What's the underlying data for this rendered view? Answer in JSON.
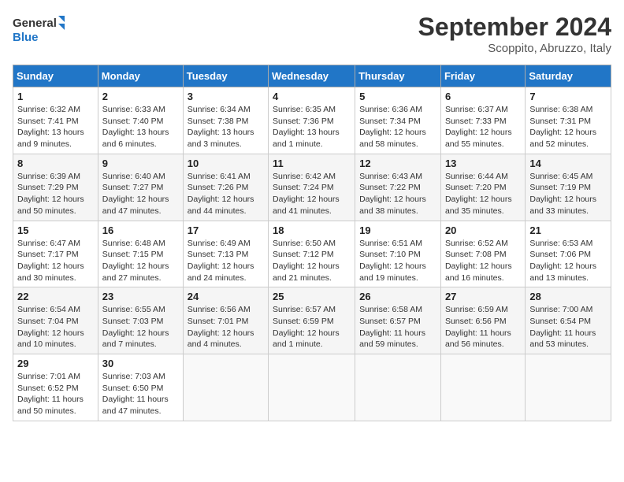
{
  "logo": {
    "line1": "General",
    "line2": "Blue"
  },
  "title": "September 2024",
  "subtitle": "Scoppito, Abruzzo, Italy",
  "days_of_week": [
    "Sunday",
    "Monday",
    "Tuesday",
    "Wednesday",
    "Thursday",
    "Friday",
    "Saturday"
  ],
  "weeks": [
    [
      {
        "day": "1",
        "detail": "Sunrise: 6:32 AM\nSunset: 7:41 PM\nDaylight: 13 hours\nand 9 minutes."
      },
      {
        "day": "2",
        "detail": "Sunrise: 6:33 AM\nSunset: 7:40 PM\nDaylight: 13 hours\nand 6 minutes."
      },
      {
        "day": "3",
        "detail": "Sunrise: 6:34 AM\nSunset: 7:38 PM\nDaylight: 13 hours\nand 3 minutes."
      },
      {
        "day": "4",
        "detail": "Sunrise: 6:35 AM\nSunset: 7:36 PM\nDaylight: 13 hours\nand 1 minute."
      },
      {
        "day": "5",
        "detail": "Sunrise: 6:36 AM\nSunset: 7:34 PM\nDaylight: 12 hours\nand 58 minutes."
      },
      {
        "day": "6",
        "detail": "Sunrise: 6:37 AM\nSunset: 7:33 PM\nDaylight: 12 hours\nand 55 minutes."
      },
      {
        "day": "7",
        "detail": "Sunrise: 6:38 AM\nSunset: 7:31 PM\nDaylight: 12 hours\nand 52 minutes."
      }
    ],
    [
      {
        "day": "8",
        "detail": "Sunrise: 6:39 AM\nSunset: 7:29 PM\nDaylight: 12 hours\nand 50 minutes."
      },
      {
        "day": "9",
        "detail": "Sunrise: 6:40 AM\nSunset: 7:27 PM\nDaylight: 12 hours\nand 47 minutes."
      },
      {
        "day": "10",
        "detail": "Sunrise: 6:41 AM\nSunset: 7:26 PM\nDaylight: 12 hours\nand 44 minutes."
      },
      {
        "day": "11",
        "detail": "Sunrise: 6:42 AM\nSunset: 7:24 PM\nDaylight: 12 hours\nand 41 minutes."
      },
      {
        "day": "12",
        "detail": "Sunrise: 6:43 AM\nSunset: 7:22 PM\nDaylight: 12 hours\nand 38 minutes."
      },
      {
        "day": "13",
        "detail": "Sunrise: 6:44 AM\nSunset: 7:20 PM\nDaylight: 12 hours\nand 35 minutes."
      },
      {
        "day": "14",
        "detail": "Sunrise: 6:45 AM\nSunset: 7:19 PM\nDaylight: 12 hours\nand 33 minutes."
      }
    ],
    [
      {
        "day": "15",
        "detail": "Sunrise: 6:47 AM\nSunset: 7:17 PM\nDaylight: 12 hours\nand 30 minutes."
      },
      {
        "day": "16",
        "detail": "Sunrise: 6:48 AM\nSunset: 7:15 PM\nDaylight: 12 hours\nand 27 minutes."
      },
      {
        "day": "17",
        "detail": "Sunrise: 6:49 AM\nSunset: 7:13 PM\nDaylight: 12 hours\nand 24 minutes."
      },
      {
        "day": "18",
        "detail": "Sunrise: 6:50 AM\nSunset: 7:12 PM\nDaylight: 12 hours\nand 21 minutes."
      },
      {
        "day": "19",
        "detail": "Sunrise: 6:51 AM\nSunset: 7:10 PM\nDaylight: 12 hours\nand 19 minutes."
      },
      {
        "day": "20",
        "detail": "Sunrise: 6:52 AM\nSunset: 7:08 PM\nDaylight: 12 hours\nand 16 minutes."
      },
      {
        "day": "21",
        "detail": "Sunrise: 6:53 AM\nSunset: 7:06 PM\nDaylight: 12 hours\nand 13 minutes."
      }
    ],
    [
      {
        "day": "22",
        "detail": "Sunrise: 6:54 AM\nSunset: 7:04 PM\nDaylight: 12 hours\nand 10 minutes."
      },
      {
        "day": "23",
        "detail": "Sunrise: 6:55 AM\nSunset: 7:03 PM\nDaylight: 12 hours\nand 7 minutes."
      },
      {
        "day": "24",
        "detail": "Sunrise: 6:56 AM\nSunset: 7:01 PM\nDaylight: 12 hours\nand 4 minutes."
      },
      {
        "day": "25",
        "detail": "Sunrise: 6:57 AM\nSunset: 6:59 PM\nDaylight: 12 hours\nand 1 minute."
      },
      {
        "day": "26",
        "detail": "Sunrise: 6:58 AM\nSunset: 6:57 PM\nDaylight: 11 hours\nand 59 minutes."
      },
      {
        "day": "27",
        "detail": "Sunrise: 6:59 AM\nSunset: 6:56 PM\nDaylight: 11 hours\nand 56 minutes."
      },
      {
        "day": "28",
        "detail": "Sunrise: 7:00 AM\nSunset: 6:54 PM\nDaylight: 11 hours\nand 53 minutes."
      }
    ],
    [
      {
        "day": "29",
        "detail": "Sunrise: 7:01 AM\nSunset: 6:52 PM\nDaylight: 11 hours\nand 50 minutes."
      },
      {
        "day": "30",
        "detail": "Sunrise: 7:03 AM\nSunset: 6:50 PM\nDaylight: 11 hours\nand 47 minutes."
      },
      {
        "day": "",
        "detail": ""
      },
      {
        "day": "",
        "detail": ""
      },
      {
        "day": "",
        "detail": ""
      },
      {
        "day": "",
        "detail": ""
      },
      {
        "day": "",
        "detail": ""
      }
    ]
  ]
}
